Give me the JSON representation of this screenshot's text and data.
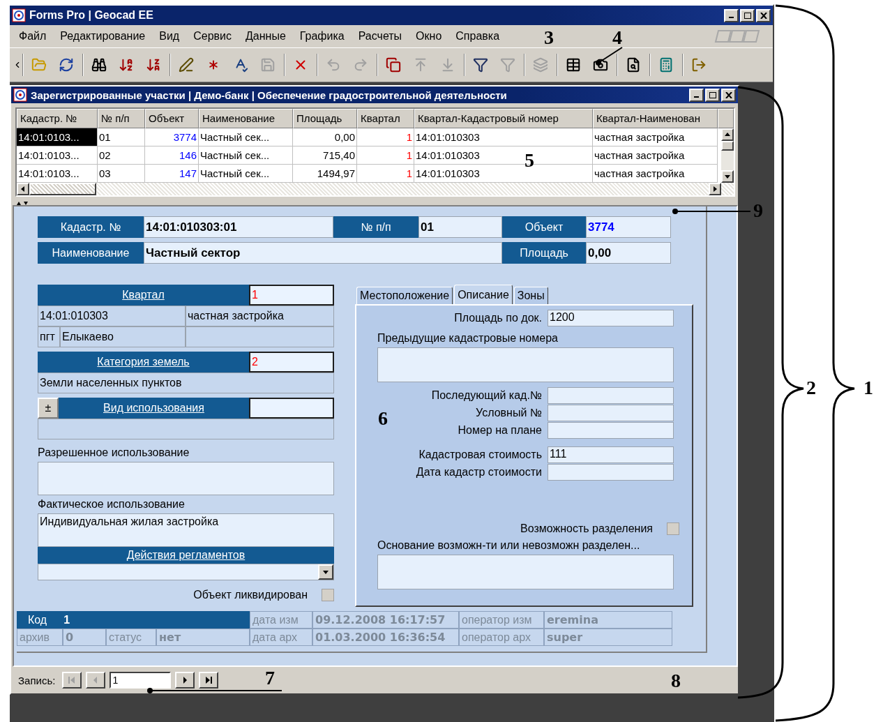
{
  "window": {
    "title": "Forms Pro | Geocad EE"
  },
  "menu": [
    "Файл",
    "Редактирование",
    "Вид",
    "Сервис",
    "Данные",
    "Графика",
    "Расчеты",
    "Окно",
    "Справка"
  ],
  "toolbar": [
    [
      {
        "disabled": false
      },
      {
        "disabled": false
      }
    ],
    [
      {
        "disabled": false
      },
      {
        "disabled": false
      },
      {
        "disabled": false
      }
    ],
    [
      {
        "disabled": false
      },
      {
        "disabled": false
      },
      {
        "disabled": false
      },
      {
        "disabled": true
      }
    ],
    [
      {
        "disabled": false
      }
    ],
    [
      {
        "disabled": true
      },
      {
        "disabled": true
      }
    ],
    [
      {
        "disabled": false
      },
      {
        "disabled": true
      },
      {
        "disabled": true
      }
    ],
    [
      {
        "disabled": false
      },
      {
        "disabled": true
      }
    ],
    [
      {
        "disabled": true
      }
    ],
    [
      {
        "disabled": false
      },
      {
        "disabled": false
      }
    ],
    [
      {
        "disabled": false
      }
    ],
    [
      {
        "disabled": false
      }
    ],
    [
      {
        "disabled": false
      }
    ]
  ],
  "child_window": {
    "title": "Зарегистрированные участки | Демо-банк | Обеспечение градостроительной деятельности"
  },
  "grid": {
    "columns": [
      {
        "label": "Кадастр. №",
        "kind": "text"
      },
      {
        "label": "№ п/п",
        "kind": "text"
      },
      {
        "label": "Объект",
        "kind": "link"
      },
      {
        "label": "Наименование",
        "kind": "text"
      },
      {
        "label": "Площадь",
        "kind": "number"
      },
      {
        "label": "Квартал",
        "kind": "ref"
      },
      {
        "label": "Квартал-Кадастровый номер",
        "kind": "text"
      },
      {
        "label": "Квартал-Наименован",
        "kind": "text"
      }
    ],
    "rows": [
      {
        "selected": true,
        "cells": [
          "14:01:0103...",
          "01",
          "3774",
          "Частный сек...",
          "0,00",
          "1",
          "14:01:010303",
          "частная застройка"
        ]
      },
      {
        "selected": false,
        "cells": [
          "14:01:0103...",
          "02",
          "146",
          "Частный сек...",
          "715,40",
          "1",
          "14:01:010303",
          "частная застройка"
        ]
      },
      {
        "selected": false,
        "cells": [
          "14:01:0103...",
          "03",
          "147",
          "Частный сек...",
          "1494,97",
          "1",
          "14:01:010303",
          "частная застройка"
        ]
      }
    ]
  },
  "form": {
    "header": [
      [
        {
          "label": "Кадастр. №",
          "value": "14:01:010303:01",
          "kind": "text"
        },
        {
          "label": "№ п/п",
          "value": "01",
          "kind": "text"
        },
        {
          "label": "Объект",
          "value": "3774",
          "kind": "link"
        }
      ],
      [
        {
          "label": "Наименование",
          "value": "Частный сектор",
          "kind": "wide"
        },
        {
          "label": "Площадь",
          "value": "0,00",
          "kind": "text"
        }
      ]
    ],
    "kvartal": {
      "link": "Квартал",
      "code": "1",
      "cadastral": "14:01:010303",
      "name": "частная застройка",
      "settlement_type": "пгт",
      "settlement": "Елыкаево"
    },
    "land_category": {
      "link": "Категория земель",
      "code": "2",
      "value": "Земли населенных пунктов"
    },
    "usage_type": {
      "button": "±",
      "link": "Вид использования"
    },
    "permitted_use": {
      "label": "Разрешенное использование"
    },
    "actual_use": {
      "label": "Фактическое использование",
      "value": "Индивидуальная жилая застройка"
    },
    "regulations": {
      "link": "Действия регламентов"
    },
    "liquidated": {
      "label": "Объект ликвидирован",
      "checked": false
    },
    "tabs": [
      {
        "label": "Местоположение",
        "selected": false
      },
      {
        "label": "Описание",
        "selected": true
      },
      {
        "label": "Зоны",
        "selected": false
      }
    ],
    "description": [
      {
        "kind": "inline",
        "label": "Площадь по док.",
        "value": "1200"
      },
      {
        "kind": "block",
        "label": "Предыдущие кадастровые номера"
      },
      {
        "kind": "inline",
        "label": "Последующий кад.№"
      },
      {
        "kind": "inline",
        "label": "Условный №"
      },
      {
        "kind": "inline",
        "label": "Номер на плане"
      },
      {
        "kind": "inline",
        "label": "Кадастровая стоимость",
        "value": "111"
      },
      {
        "kind": "inline",
        "label": "Дата кадастр стоимости"
      },
      {
        "kind": "check",
        "label": "Возможность разделения",
        "checked": false
      },
      {
        "kind": "block",
        "label": "Основание возможн-ти или невозможн разделен..."
      }
    ],
    "record_info": {
      "code_label": "Код",
      "code": "1",
      "changed_label": "дата изм",
      "changed": "09.12.2008 16:17:57",
      "changed_by_label": "оператор изм",
      "changed_by": "eremina",
      "archive_label": "архив",
      "archive": "0",
      "status_label": "статус",
      "status": "нет",
      "archived_label": "дата арх",
      "archived": "01.03.2000 16:36:54",
      "archived_by_label": "оператор арх",
      "archived_by": "super"
    }
  },
  "record_nav": {
    "label": "Запись:",
    "value": "1",
    "buttons": [
      {
        "disabled": true
      },
      {
        "disabled": true
      },
      {
        "disabled": false
      },
      {
        "disabled": false
      }
    ]
  },
  "callouts": [
    "1",
    "2",
    "3",
    "4",
    "5",
    "6",
    "7",
    "8",
    "9"
  ]
}
